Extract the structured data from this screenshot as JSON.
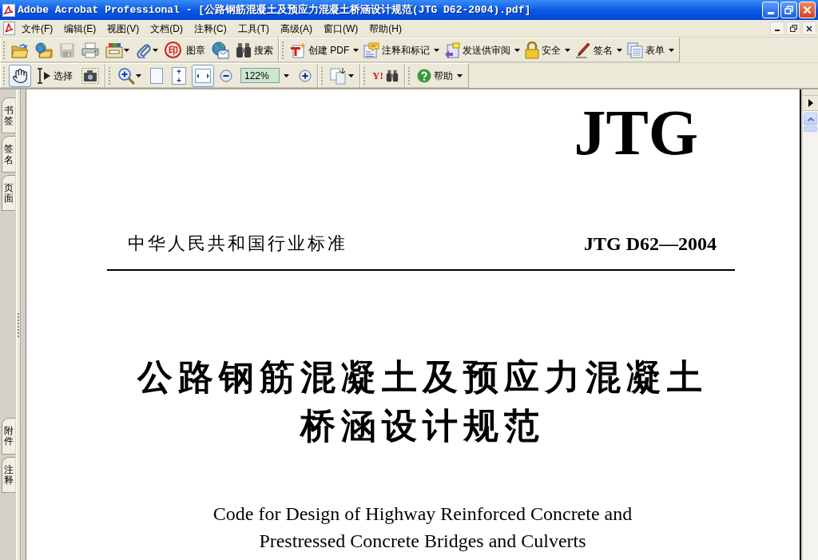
{
  "window": {
    "title": "Adobe Acrobat Professional - [公路钢筋混凝土及预应力混凝土桥涵设计规范(JTG D62-2004).pdf]"
  },
  "menu_bar": {
    "items": [
      "文件(F)",
      "编辑(E)",
      "视图(V)",
      "文档(D)",
      "注释(C)",
      "工具(T)",
      "高级(A)",
      "窗口(W)",
      "帮助(H)"
    ]
  },
  "toolbar_rows": [
    {
      "toolbars": [
        {
          "buttons": [
            {
              "kind": "button",
              "dropdown": false,
              "disabled": false
            },
            {
              "kind": "button",
              "dropdown": false,
              "disabled": false
            },
            {
              "kind": "button",
              "dropdown": false,
              "disabled": true
            },
            {
              "kind": "button",
              "dropdown": false,
              "disabled": false
            },
            {
              "kind": "button",
              "dropdown": true,
              "disabled": false
            },
            {
              "kind": "button",
              "dropdown": true,
              "disabled": false
            },
            {
              "kind": "button",
              "glyph": "印",
              "label": "图章",
              "dropdown": false,
              "disabled": false
            },
            {
              "kind": "button",
              "dropdown": false,
              "disabled": false
            },
            {
              "kind": "button",
              "label": "搜索",
              "dropdown": false,
              "disabled": false
            }
          ]
        },
        {
          "buttons": [
            {
              "kind": "button",
              "label": "创建 PDF",
              "dropdown": true
            },
            {
              "kind": "button",
              "label": "注释和标记",
              "dropdown": true
            },
            {
              "kind": "button",
              "label": "发送供审阅",
              "dropdown": true
            },
            {
              "kind": "button",
              "label": "安全",
              "dropdown": true
            },
            {
              "kind": "button",
              "label": "签名",
              "dropdown": true
            },
            {
              "kind": "button",
              "label": "表单",
              "dropdown": true
            }
          ]
        }
      ]
    },
    {
      "toolbars": [
        {
          "buttons": [
            {
              "kind": "button",
              "selected": true,
              "dropdown": false
            },
            {
              "kind": "button",
              "label": "选择",
              "selected": false,
              "dropdown": false
            },
            {
              "kind": "button",
              "selected": false,
              "dropdown": false
            }
          ]
        },
        {
          "buttons": [
            {
              "kind": "button",
              "selected": false,
              "dropdown": true
            },
            {
              "kind": "button",
              "selected": false,
              "dropdown": false
            },
            {
              "kind": "button",
              "selected": false,
              "dropdown": false
            },
            {
              "kind": "button",
              "selected": true,
              "dropdown": false
            },
            {
              "kind": "button",
              "selected": false,
              "dropdown": false
            },
            {
              "kind": "field",
              "value": "122%",
              "dropdown": true
            },
            {
              "kind": "button",
              "selected": false,
              "dropdown": false
            }
          ]
        },
        {
          "buttons": [
            {
              "kind": "button",
              "dropdown": true
            }
          ]
        },
        {
          "buttons": [
            {
              "kind": "button",
              "glyph": "Y!",
              "dropdown": false
            }
          ]
        },
        {
          "buttons": [
            {
              "kind": "button",
              "label": "帮助",
              "dropdown": true
            }
          ]
        }
      ]
    }
  ],
  "navigation_panel": {
    "top_tabs": [
      "书签",
      "签名",
      "页面"
    ],
    "bottom_tabs": [
      "附件",
      "注释"
    ]
  },
  "document": {
    "logo": "JTG",
    "category": "中华人民共和国行业标准",
    "code": "JTG D62—2004",
    "title_lines": [
      "公路钢筋混凝土及预应力混凝土",
      "桥涵设计规范"
    ],
    "english_title_lines": [
      "Code for Design of Highway Reinforced Concrete and",
      "Prestressed Concrete Bridges and Culverts"
    ]
  }
}
